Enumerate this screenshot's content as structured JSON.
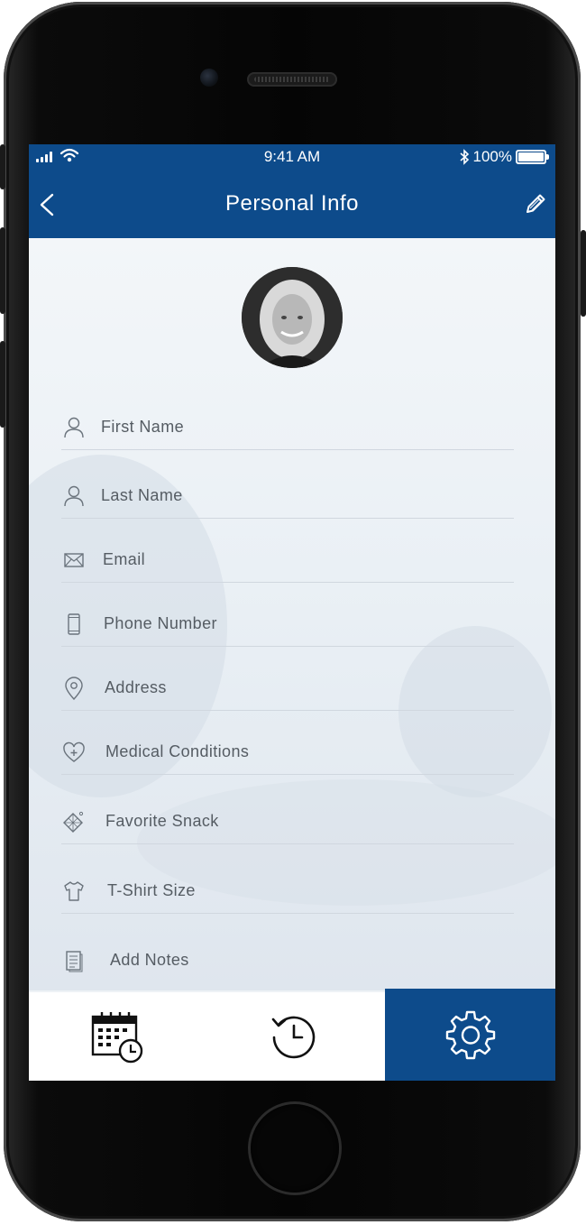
{
  "status_bar": {
    "time": "9:41 AM",
    "battery": "100%"
  },
  "header": {
    "title": "Personal Info"
  },
  "profile": {
    "avatar_alt": "profile photo"
  },
  "form": {
    "fields": [
      {
        "label": "First Name",
        "icon": "person-icon"
      },
      {
        "label": "Last Name",
        "icon": "person-icon"
      },
      {
        "label": "Email",
        "icon": "envelope-icon"
      },
      {
        "label": "Phone Number",
        "icon": "phone-icon"
      },
      {
        "label": "Address",
        "icon": "map-pin-icon"
      },
      {
        "label": "Medical Conditions",
        "icon": "heart-plus-icon"
      },
      {
        "label": "Favorite Snack",
        "icon": "snack-icon"
      },
      {
        "label": "T-Shirt Size",
        "icon": "tshirt-icon"
      },
      {
        "label": "Add Notes",
        "icon": "notes-icon"
      }
    ]
  },
  "tab_bar": {
    "tabs": [
      {
        "name": "schedule",
        "icon": "calendar-clock-icon",
        "active": false
      },
      {
        "name": "history",
        "icon": "history-icon",
        "active": false
      },
      {
        "name": "settings",
        "icon": "gear-icon",
        "active": true
      }
    ]
  },
  "colors": {
    "primary": "#0d4b8b",
    "text": "#555c63",
    "divider": "#d0d7df"
  }
}
